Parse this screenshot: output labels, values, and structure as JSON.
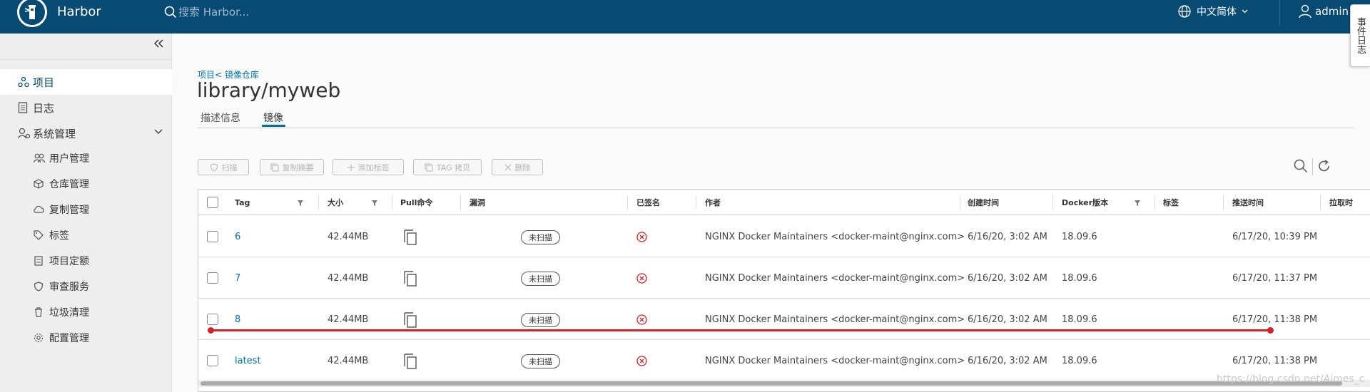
{
  "header": {
    "brand": "Harbor",
    "search_placeholder": "搜索 Harbor...",
    "language": "中文简体",
    "user": "admin",
    "event_tab": "事件日志"
  },
  "sidebar": {
    "items": [
      {
        "label": "项目",
        "icon": "project-icon",
        "active": true
      },
      {
        "label": "日志",
        "icon": "log-icon"
      },
      {
        "label": "系统管理",
        "icon": "admin-icon",
        "expanded": true
      }
    ],
    "sub_items": [
      {
        "label": "用户管理",
        "icon": "users-icon"
      },
      {
        "label": "仓库管理",
        "icon": "registry-icon"
      },
      {
        "label": "复制管理",
        "icon": "replication-icon"
      },
      {
        "label": "标签",
        "icon": "tag-icon"
      },
      {
        "label": "项目定额",
        "icon": "quota-icon"
      },
      {
        "label": "审查服务",
        "icon": "shield-icon"
      },
      {
        "label": "垃圾清理",
        "icon": "trash-icon"
      },
      {
        "label": "配置管理",
        "icon": "gear-icon"
      }
    ]
  },
  "page": {
    "breadcrumb": "项目< 镜像仓库",
    "title": "library/myweb",
    "tabs": [
      "描述信息",
      "镜像"
    ],
    "active_tab": "镜像"
  },
  "toolbar": {
    "buttons": [
      "扫描",
      "复制摘要",
      "添加标签",
      "TAG 拷贝",
      "删除"
    ]
  },
  "table": {
    "columns": [
      "Tag",
      "大小",
      "Pull命令",
      "漏洞",
      "已签名",
      "作者",
      "创建时间",
      "Docker版本",
      "标签",
      "推送时间",
      "拉取时"
    ],
    "rows": [
      {
        "tag": "6",
        "size": "42.44MB",
        "vuln": "未扫描",
        "author": "NGINX Docker Maintainers <docker-maint@nginx.com>",
        "created": "6/16/20, 3:02 AM",
        "docker": "18.09.6",
        "push": "6/17/20, 10:39 PM"
      },
      {
        "tag": "7",
        "size": "42.44MB",
        "vuln": "未扫描",
        "author": "NGINX Docker Maintainers <docker-maint@nginx.com>",
        "created": "6/16/20, 3:02 AM",
        "docker": "18.09.6",
        "push": "6/17/20, 11:37 PM"
      },
      {
        "tag": "8",
        "size": "42.44MB",
        "vuln": "未扫描",
        "author": "NGINX Docker Maintainers <docker-maint@nginx.com>",
        "created": "6/16/20, 3:02 AM",
        "docker": "18.09.6",
        "push": "6/17/20, 11:38 PM"
      },
      {
        "tag": "latest",
        "size": "42.44MB",
        "vuln": "未扫描",
        "author": "NGINX Docker Maintainers <docker-maint@nginx.com>",
        "created": "6/16/20, 3:02 AM",
        "docker": "18.09.6",
        "push": "6/17/20, 11:38 PM"
      }
    ]
  },
  "watermark": "https://blog.csdn.net/Aimes_c"
}
